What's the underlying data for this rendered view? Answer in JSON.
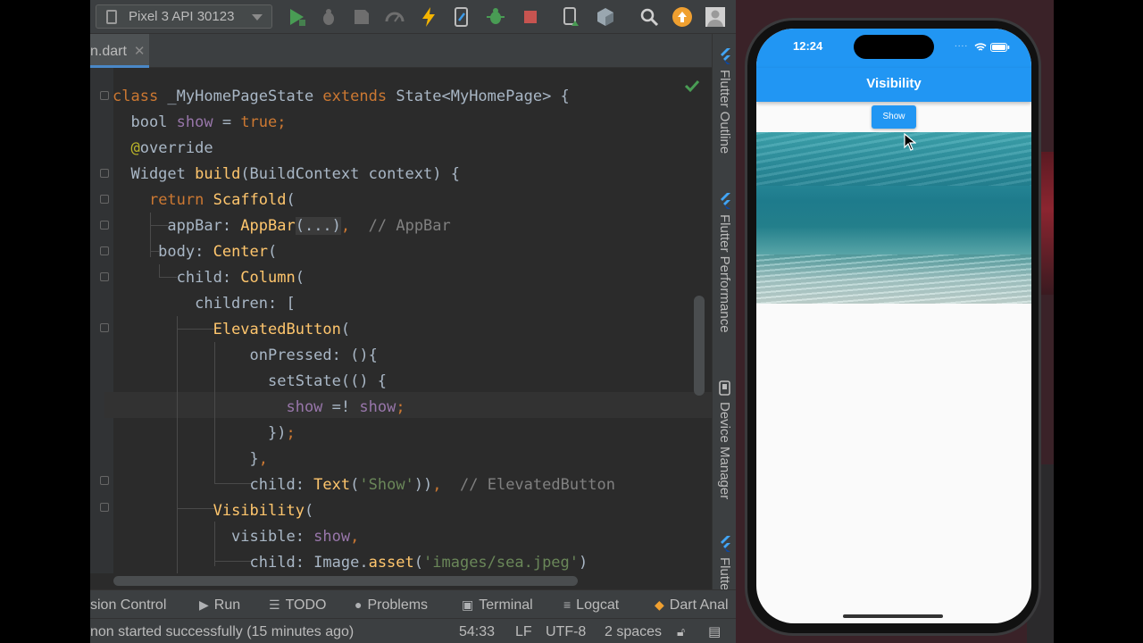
{
  "toolbar": {
    "device": "Pixel 3 API 30123"
  },
  "editor": {
    "file_tab": "n.dart"
  },
  "side_panel": {
    "flutter_outline": "Flutter Outline",
    "flutter_performance": "Flutter Performance",
    "device_manager": "Device Manager",
    "flutter_partial": "Flutte"
  },
  "bottom_tools": {
    "version_control": "sion Control",
    "run": "Run",
    "todo": "TODO",
    "problems": "Problems",
    "terminal": "Terminal",
    "logcat": "Logcat",
    "dart_analysis": "Dart Anal"
  },
  "status_bar": {
    "message": "non started successfully (15 minutes ago)",
    "position": "54:33",
    "line_sep": "LF",
    "encoding": "UTF-8",
    "indent": "2 spaces"
  },
  "phone": {
    "time": "12:24",
    "app_title": "Visibility",
    "button_label": "Show"
  },
  "colors": {
    "accent": "#2196f3",
    "keyword": "#cc7832",
    "function": "#ffc66d",
    "field": "#9876aa",
    "string": "#6a8759"
  }
}
